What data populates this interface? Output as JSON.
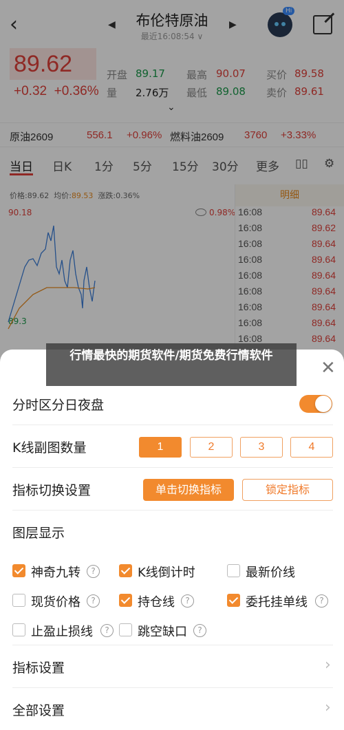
{
  "header": {
    "title": "布伦特原油",
    "subtitle": "最近16:08:54 ∨",
    "robot_badge": "Hi"
  },
  "quote": {
    "price": "89.62",
    "change": "+0.32",
    "change_pct": "+0.36%",
    "open_label": "开盘",
    "open": "89.17",
    "high_label": "最高",
    "high": "90.07",
    "bid_label": "买价",
    "bid": "89.58",
    "vol_label": "量",
    "vol": "2.76万",
    "low_label": "最低",
    "low": "89.08",
    "ask_label": "卖价",
    "ask": "89.61"
  },
  "ticker": {
    "name1": "原油2609",
    "price1": "556.1",
    "pct1": "+0.96%",
    "name2": "燃料油2609",
    "price2": "3760",
    "pct2": "+3.33%"
  },
  "tabs": [
    "当日",
    "日K",
    "1分",
    "5分",
    "15分",
    "30分",
    "更多"
  ],
  "chart_info": {
    "price_label": "价格:",
    "price": "89.62",
    "avg_label": "均价:",
    "avg": "89.53",
    "chg_label": "涨跌:",
    "chg": "0.36%",
    "y_high": "90.18",
    "y_low": "89.3",
    "pct_right": "0.98%"
  },
  "detail": {
    "header": "明细",
    "rows": [
      {
        "time": "16:08",
        "value": "89.64"
      },
      {
        "time": "16:08",
        "value": "89.62"
      },
      {
        "time": "16:08",
        "value": "89.64"
      },
      {
        "time": "16:08",
        "value": "89.64"
      },
      {
        "time": "16:08",
        "value": "89.64"
      },
      {
        "time": "16:08",
        "value": "89.64"
      },
      {
        "time": "16:08",
        "value": "89.64"
      },
      {
        "time": "16:08",
        "value": "89.64"
      },
      {
        "time": "16:08",
        "value": "89.64"
      }
    ]
  },
  "banner": "行情最快的期货软件/期货免费行情软件",
  "sheet": {
    "night_label": "分时区分日夜盘",
    "kline_label": "K线副图数量",
    "kline_options": [
      "1",
      "2",
      "3",
      "4"
    ],
    "indicator_switch_label": "指标切换设置",
    "switch_btn": "单击切换指标",
    "lock_btn": "锁定指标",
    "layers_label": "图层显示",
    "checkboxes": [
      {
        "label": "神奇九转",
        "checked": true
      },
      {
        "label": "K线倒计时",
        "checked": true
      },
      {
        "label": "最新价线",
        "checked": false
      },
      {
        "label": "现货价格",
        "checked": false
      },
      {
        "label": "持仓线",
        "checked": true
      },
      {
        "label": "委托挂单线",
        "checked": true
      },
      {
        "label": "止盈止损线",
        "checked": false
      },
      {
        "label": "跳空缺口",
        "checked": false
      }
    ],
    "indicator_settings": "指标设置",
    "all_settings": "全部设置"
  },
  "colors": {
    "accent": "#f28a2e",
    "up": "#e0403a",
    "down": "#1a9a4a"
  }
}
